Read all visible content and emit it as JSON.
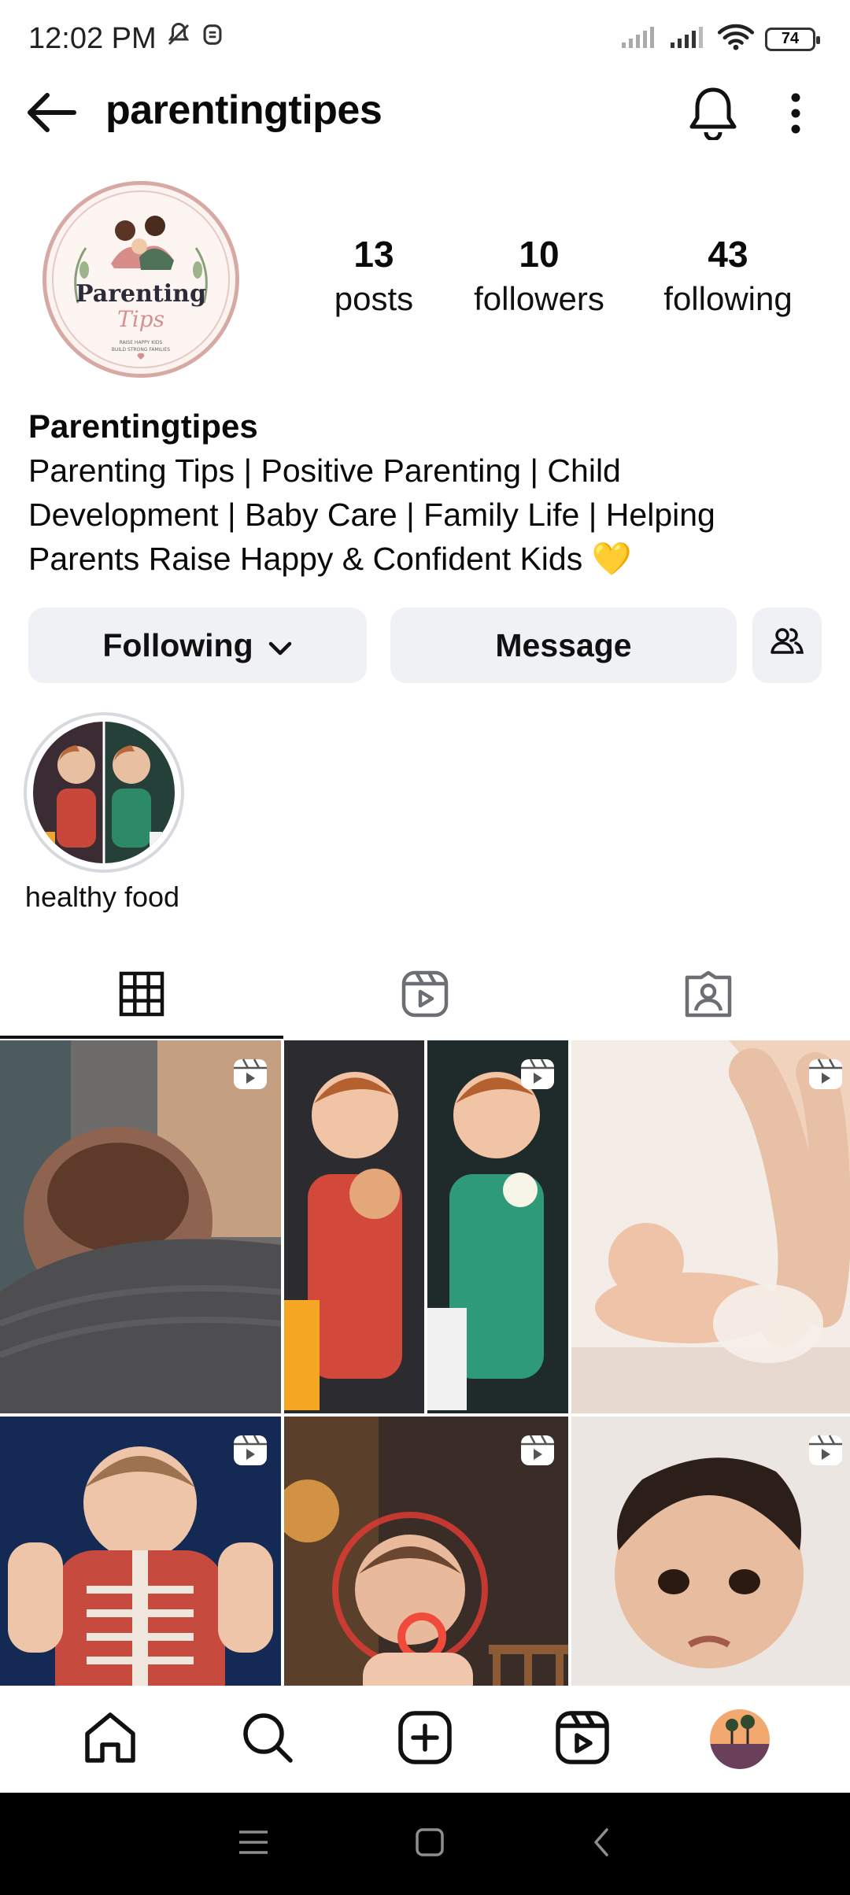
{
  "status_bar": {
    "time": "12:02 PM",
    "battery": "74",
    "icons": [
      "mute-bell-icon",
      "alarm-icon",
      "signal-icon",
      "signal-icon",
      "wifi-icon",
      "battery-icon"
    ]
  },
  "header": {
    "username": "parentingtipes",
    "icons": [
      "back-arrow-icon",
      "bell-icon",
      "more-vertical-icon"
    ]
  },
  "profile": {
    "avatar": {
      "logo_text": "Parenting",
      "logo_script": "Tips",
      "logo_tagline_1": "RAISE HAPPY KIDS",
      "logo_tagline_2": "BUILD STRONG FAMILIES"
    },
    "stats": {
      "posts": {
        "count": "13",
        "label": "posts"
      },
      "followers": {
        "count": "10",
        "label": "followers"
      },
      "following": {
        "count": "43",
        "label": "following"
      }
    },
    "display_name": "Parentingtipes",
    "bio_lines": [
      "Parenting Tips | Positive Parenting | Child",
      "Development | Baby Care | Family Life | Helping",
      "Parents Raise Happy & Confident Kids 💛"
    ]
  },
  "actions": {
    "following_label": "Following",
    "message_label": "Message"
  },
  "highlights": [
    {
      "label": "healthy food"
    }
  ],
  "tabs": [
    "grid-icon",
    "reels-icon",
    "tagged-icon"
  ],
  "grid": {
    "posts": [
      {
        "type": "reel"
      },
      {
        "type": "reel"
      },
      {
        "type": "reel"
      },
      {
        "type": "reel"
      },
      {
        "type": "reel"
      },
      {
        "type": "reel"
      }
    ]
  },
  "bottom_nav": [
    "home-icon",
    "search-icon",
    "create-icon",
    "reels-icon",
    "profile-avatar"
  ],
  "colors": {
    "button_bg": "#eff1f4",
    "text": "#0a0a0a",
    "avatar_border": "#d7a9a5"
  }
}
